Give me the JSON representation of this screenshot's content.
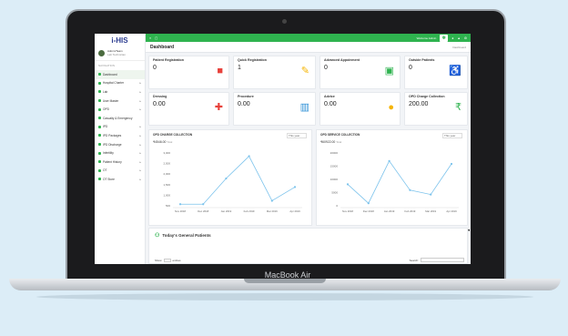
{
  "device": {
    "label": "MacBook Air"
  },
  "app": {
    "logo": "i-HIS"
  },
  "user": {
    "name": "Admin/Team",
    "role": "Lab Technician"
  },
  "sidebar": {
    "header": "NAVIGATION",
    "items": [
      {
        "label": "Dashboard",
        "arrow": ""
      },
      {
        "label": "Hospital Charter",
        "arrow": "▸"
      },
      {
        "label": "Lab",
        "arrow": "▸"
      },
      {
        "label": "User Master",
        "arrow": "▸"
      },
      {
        "label": "OPD",
        "arrow": "▸"
      },
      {
        "label": "Casualty & Emergency",
        "arrow": ""
      },
      {
        "label": "IPD",
        "arrow": "▸"
      },
      {
        "label": "IPD Packages",
        "arrow": "▸"
      },
      {
        "label": "IPD Discharge",
        "arrow": "▸"
      },
      {
        "label": "Infertility",
        "arrow": "▸"
      },
      {
        "label": "Patient History",
        "arrow": "▸"
      },
      {
        "label": "OT",
        "arrow": "▸"
      },
      {
        "label": "OT Store",
        "arrow": "▸"
      }
    ]
  },
  "topbar": {
    "menu_icon": "≡",
    "expand_icon": "▢",
    "welcome": "Welcome Admin",
    "icons": [
      "●",
      "▲",
      "⚙"
    ]
  },
  "page": {
    "title": "Dashboard",
    "breadcrumb": "Dashboard"
  },
  "cards": [
    {
      "title": "Patient Registration",
      "value": "0",
      "icon": "■",
      "color": "#e8413b"
    },
    {
      "title": "Quick Registration",
      "value": "1",
      "icon": "✎",
      "color": "#f5b400"
    },
    {
      "title": "Advanced Appoinment",
      "value": "0",
      "icon": "▣",
      "color": "#2fb34f"
    },
    {
      "title": "Outside Patients",
      "value": "0",
      "icon": "♿",
      "color": "#3aa7e0"
    },
    {
      "title": "Dressing",
      "value": "0.00",
      "icon": "✚",
      "color": "#e8413b"
    },
    {
      "title": "Procedure",
      "value": "0.00",
      "icon": "▥",
      "color": "#2c8fd6"
    },
    {
      "title": "Advice",
      "value": "0.00",
      "icon": "●",
      "color": "#f5b400"
    },
    {
      "title": "OPD Charge Collection",
      "value": "200.00",
      "icon": "₹",
      "color": "#2fb34f"
    }
  ],
  "charts": [
    {
      "title": "OPD CHARGE COLLECTION",
      "select": "This year",
      "total": "₹4546.00",
      "total_suffix": "Total",
      "y_ticks": [
        "3,000",
        "2,500",
        "2,000",
        "1,500",
        "1,000",
        "500"
      ],
      "chart_data": {
        "type": "line",
        "categories": [
          "Nov 2018",
          "Dec 2018",
          "Jan 2019",
          "Feb 2019",
          "Mar 2019",
          "Apr 2019"
        ],
        "values": [
          200,
          200,
          1700,
          3000,
          400,
          1200
        ],
        "ylim": [
          0,
          3400
        ],
        "color": "#7cc3ec"
      }
    },
    {
      "title": "OPD SERVICE COLLECTION",
      "select": "This year",
      "total": "₹60922.00",
      "total_suffix": "Total",
      "y_ticks": [
        "20000",
        "15000",
        "10000",
        "5000",
        "0"
      ],
      "chart_data": {
        "type": "line",
        "categories": [
          "Nov 2018",
          "Dec 2018",
          "Jan 2019",
          "Feb 2019",
          "Mar 2019",
          "Apr 2019"
        ],
        "values": [
          8000,
          1500,
          16000,
          6000,
          4500,
          15000
        ],
        "ylim": [
          0,
          20000
        ],
        "color": "#7cc3ec"
      }
    }
  ],
  "patients": {
    "title": "Today's General Patients",
    "show_label": "Show",
    "entries_label": "entries",
    "search_label": "Search:"
  },
  "collapse_icon": "◂"
}
